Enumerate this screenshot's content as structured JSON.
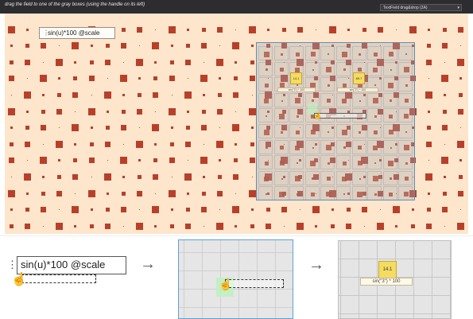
{
  "titlebar": {
    "title": "drag the field to one of the gray boxes (using the handle on its left)",
    "app_label": "TextField drag&drop (2A)",
    "dropdown_arrow": "▾"
  },
  "colors": {
    "background": "#fde6cc",
    "square": "#b8402a",
    "panel_border": "#5f8fb4",
    "highlight_yellow": "#f4dc63"
  },
  "icons": {
    "drag_handle": "drag-handle-icon",
    "hand_cursor": "hand-cursor-icon",
    "arrow": "arrow-right-icon"
  },
  "main_field": {
    "handle": "⋮",
    "value": "sin(u)*100 @scale"
  },
  "panel": {
    "box1_value": "14.1",
    "box1_caption": "sin(\"3\") * 100",
    "box2_value": "89.7",
    "box2_caption": "sin(\"2\") * 100"
  },
  "steps": {
    "step1_handle": "⋮",
    "step1_value": "sin(u)*100 @scale",
    "arrow": "→",
    "step3_value": "14.1",
    "step3_caption": "sin(\"3\") * 100"
  }
}
